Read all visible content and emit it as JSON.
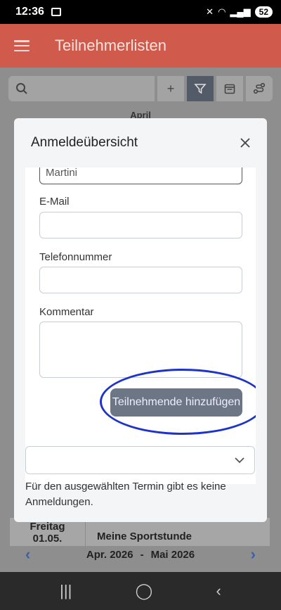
{
  "status": {
    "time": "12:36",
    "battery": "52"
  },
  "app": {
    "title": "Teilnehmerlisten"
  },
  "background": {
    "month": "April",
    "day_name": "Freitag",
    "day_date": "01.05.",
    "event_title": "Meine Sportstunde",
    "range_start": "Apr. 2026",
    "range_sep": "-",
    "range_end": "Mai 2026"
  },
  "dialog": {
    "title": "Anmeldeübersicht",
    "lastname_value": "Martini",
    "email_label": "E-Mail",
    "phone_label": "Telefonnummer",
    "comment_label": "Kommentar",
    "add_button": "Teilnehmende hinzufügen",
    "select_value": "",
    "info_text": "Für den ausgewählten Termin gibt es keine Anmeldungen."
  },
  "colors": {
    "app_bar": "#d05a4b",
    "primary_button": "#6c7685",
    "highlight_ring": "#1e34c9"
  }
}
